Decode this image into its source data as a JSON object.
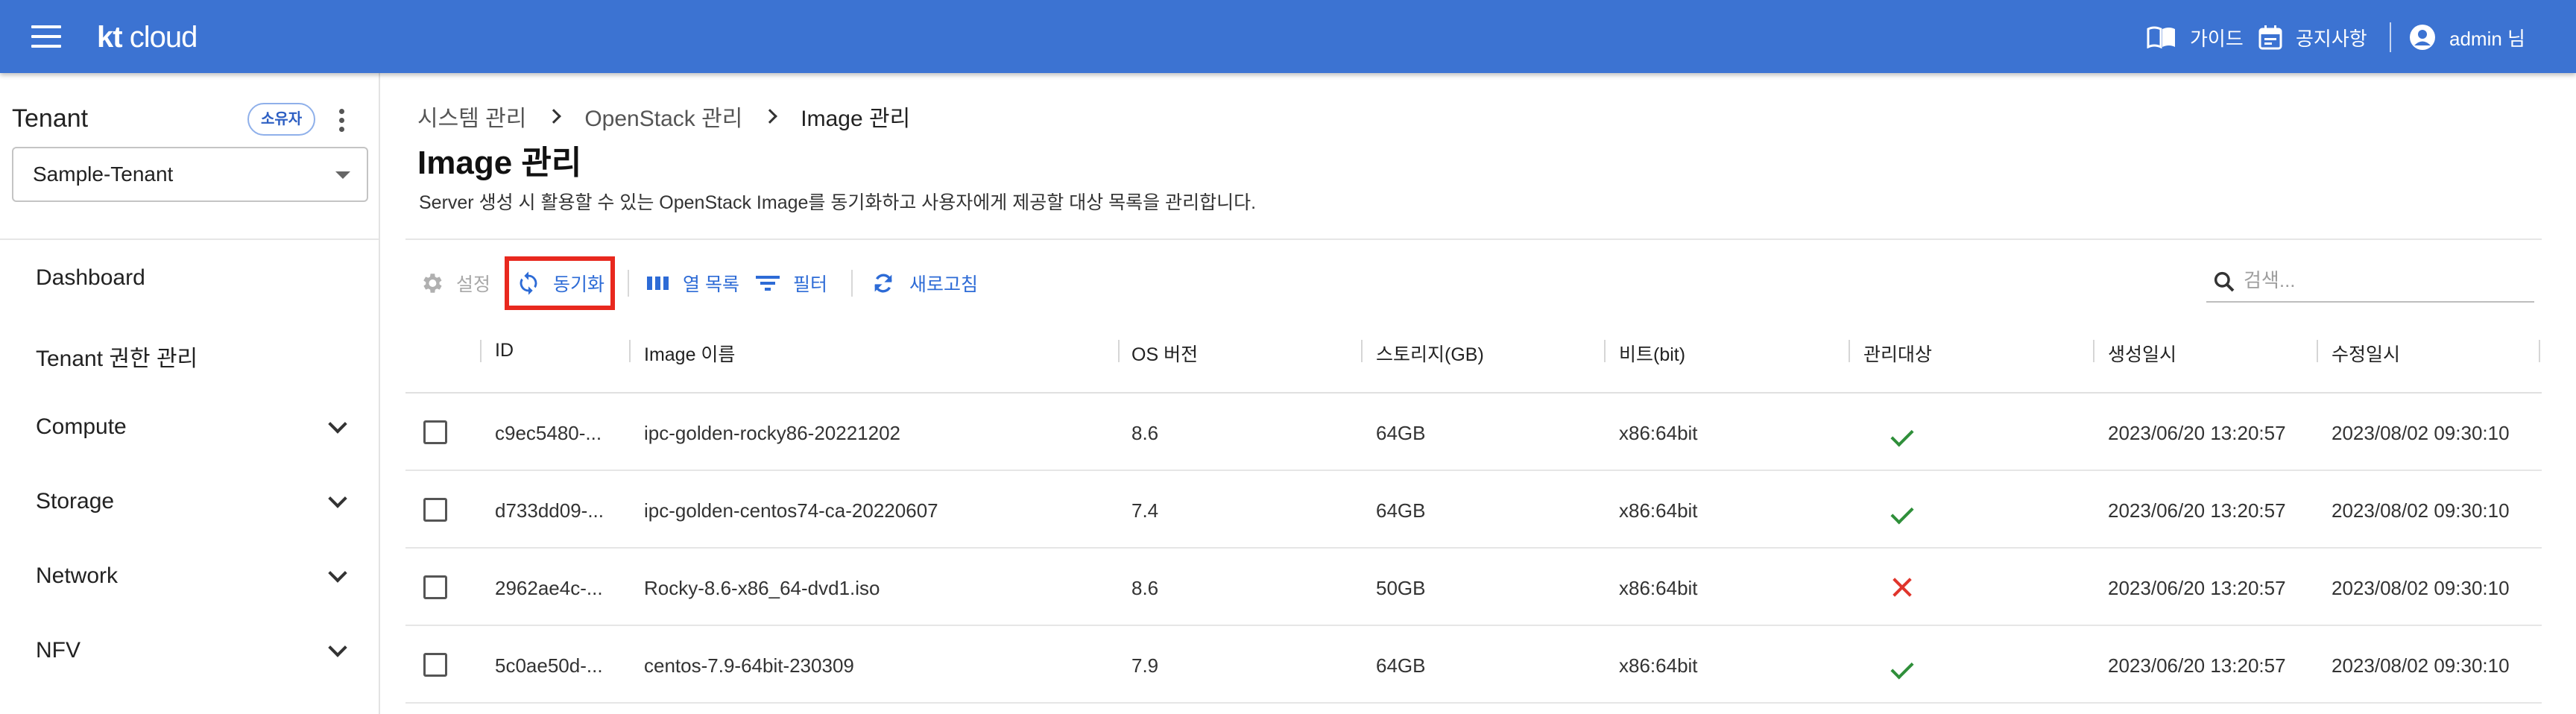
{
  "header": {
    "logo_kt": "kt",
    "logo_cloud": "cloud",
    "guide_label": "가이드",
    "notice_label": "공지사항",
    "user_label": "admin 님",
    "bg_color": "#3c73d2"
  },
  "sidebar": {
    "tenant_title": "Tenant",
    "owner_badge": "소유자",
    "tenant_selected": "Sample-Tenant",
    "items": [
      {
        "label": "Dashboard",
        "expandable": false
      },
      {
        "label": "Tenant 권한 관리",
        "expandable": false
      },
      {
        "label": "Compute",
        "expandable": true
      },
      {
        "label": "Storage",
        "expandable": true
      },
      {
        "label": "Network",
        "expandable": true
      },
      {
        "label": "NFV",
        "expandable": true
      }
    ]
  },
  "breadcrumb": [
    "시스템 관리",
    "OpenStack 관리",
    "Image 관리"
  ],
  "page": {
    "title": "Image 관리",
    "description": "Server 생성 시 활용할 수 있는 OpenStack Image를 동기화하고 사용자에게 제공할 대상 목록을 관리합니다."
  },
  "toolbar": {
    "settings_label": "설정",
    "sync_label": "동기화",
    "columns_label": "열 목록",
    "filter_label": "필터",
    "refresh_label": "새로고침",
    "search_placeholder": "검색...",
    "highlight_color": "#e8281e"
  },
  "table": {
    "columns": [
      "ID",
      "Image 이름",
      "OS 버전",
      "스토리지(GB)",
      "비트(bit)",
      "관리대상",
      "생성일시",
      "수정일시"
    ],
    "rows": [
      {
        "id": "c9ec5480-...",
        "name": "ipc-golden-rocky86-20221202",
        "os": "8.6",
        "storage": "64GB",
        "bit": "x86:64bit",
        "managed": true,
        "created": "2023/06/20 13:20:57",
        "modified": "2023/08/02 09:30:10"
      },
      {
        "id": "d733dd09-...",
        "name": "ipc-golden-centos74-ca-20220607",
        "os": "7.4",
        "storage": "64GB",
        "bit": "x86:64bit",
        "managed": true,
        "created": "2023/06/20 13:20:57",
        "modified": "2023/08/02 09:30:10"
      },
      {
        "id": "2962ae4c-...",
        "name": "Rocky-8.6-x86_64-dvd1.iso",
        "os": "8.6",
        "storage": "50GB",
        "bit": "x86:64bit",
        "managed": false,
        "created": "2023/06/20 13:20:57",
        "modified": "2023/08/02 09:30:10"
      },
      {
        "id": "5c0ae50d-...",
        "name": "centos-7.9-64bit-230309",
        "os": "7.9",
        "storage": "64GB",
        "bit": "x86:64bit",
        "managed": true,
        "created": "2023/06/20 13:20:57",
        "modified": "2023/08/02 09:30:10"
      }
    ]
  }
}
